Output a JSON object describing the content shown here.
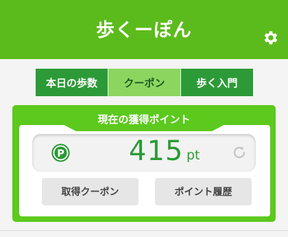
{
  "app": {
    "title": "歩くーぽん"
  },
  "icons": {
    "settings": "gear-icon",
    "points": "p-coin-icon",
    "refresh": "refresh-icon"
  },
  "tabs": [
    {
      "label": "本日の歩数",
      "active": false
    },
    {
      "label": "クーポン",
      "active": true
    },
    {
      "label": "歩く入門",
      "active": false
    }
  ],
  "points_panel": {
    "heading": "現在の獲得ポイント",
    "value": "415",
    "unit": "pt"
  },
  "buttons": {
    "coupons": "取得クーポン",
    "history": "ポイント履歴"
  },
  "colors": {
    "brand": "#5cbb1c",
    "tab_dark": "#2d9a38",
    "tab_active": "#8cd65f",
    "points_text": "#2a9a35"
  }
}
